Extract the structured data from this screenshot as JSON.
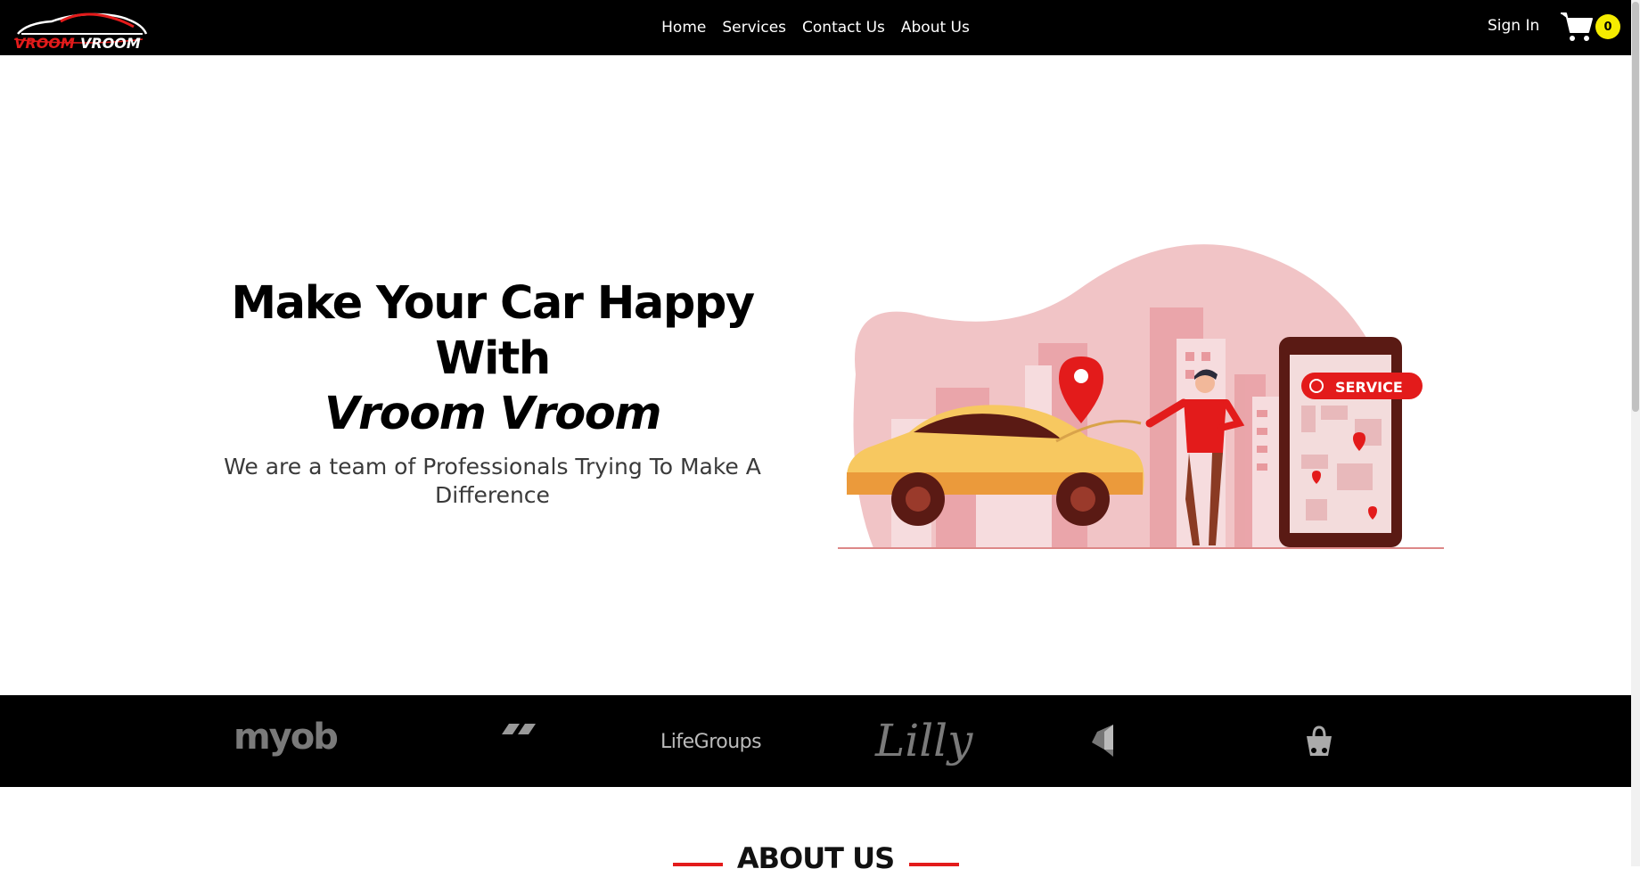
{
  "brand": {
    "logo_text_left": "VROOM",
    "logo_text_right": "VROOM"
  },
  "nav": {
    "links": [
      "Home",
      "Services",
      "Contact Us",
      "About Us"
    ],
    "signin": "Sign In",
    "cart_count": "0"
  },
  "hero": {
    "title_line1": "Make Your Car Happy With",
    "title_brand": "Vroom Vroom",
    "subtitle": "We are a team of Professionals Trying To Make A Difference",
    "illustration_label": "SERVICE"
  },
  "partners": {
    "myob": "myob",
    "lifegroups": "LifeGroups",
    "lilly": "Lilly"
  },
  "about": {
    "heading": "ABOUT US"
  },
  "colors": {
    "accent_red": "#e31b1b",
    "badge_yellow": "#f5ec00",
    "nav_bg": "#000000"
  },
  "icons": [
    "car-logo-icon",
    "cart-icon",
    "map-pin-icon",
    "search-icon"
  ]
}
